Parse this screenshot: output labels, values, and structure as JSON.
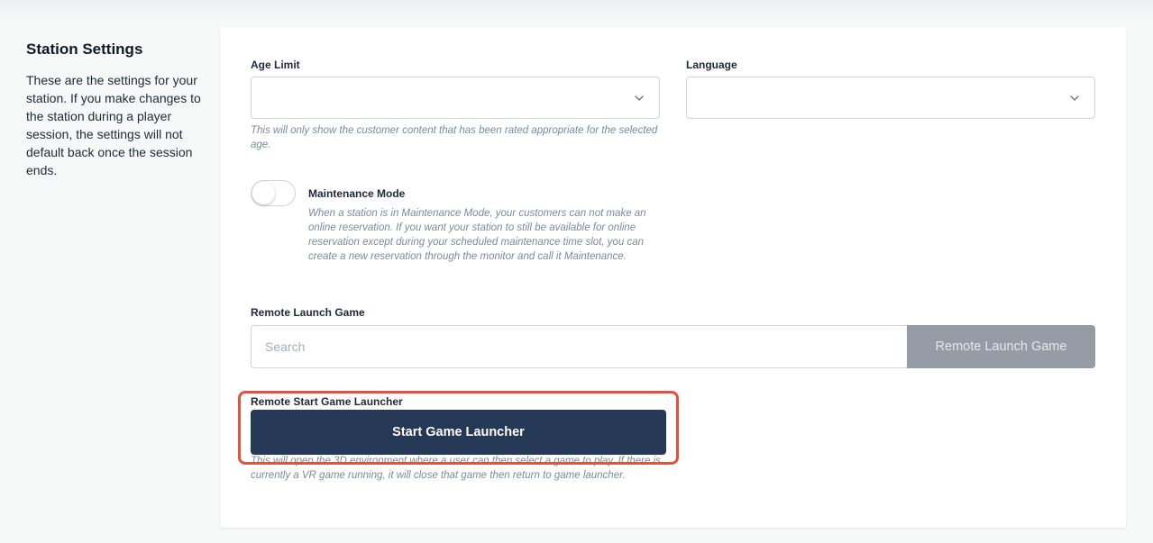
{
  "section": {
    "title": "Station Settings",
    "description": "These are the settings for your station. If you make changes to the station during a player session, the settings will not default back once the session ends."
  },
  "age_limit": {
    "label": "Age Limit",
    "value": "",
    "help": "This will only show the customer content that has been rated appropriate for the selected age."
  },
  "language": {
    "label": "Language",
    "value": ""
  },
  "maintenance": {
    "label": "Maintenance Mode",
    "enabled": false,
    "help": "When a station is in Maintenance Mode, your customers can not make an online reservation. If you want your station to still be available for online reservation except during your scheduled maintenance time slot, you can create a new reservation through the monitor and call it Maintenance."
  },
  "remote_launch": {
    "label": "Remote Launch Game",
    "search_placeholder": "Search",
    "button_label": "Remote Launch Game"
  },
  "remote_start": {
    "label": "Remote Start Game Launcher",
    "button_label": "Start Game Launcher",
    "help": "This will open the 3D environment where a user can then select a game to play. If there is currently a VR game running, it will close that game then return to game launcher."
  },
  "colors": {
    "primary_button": "#253856",
    "disabled_button": "#959ca6",
    "highlight": "#e2533f",
    "help_text": "#7b8a9e"
  },
  "icons": {
    "select_chevron": "chevron-down-icon"
  }
}
